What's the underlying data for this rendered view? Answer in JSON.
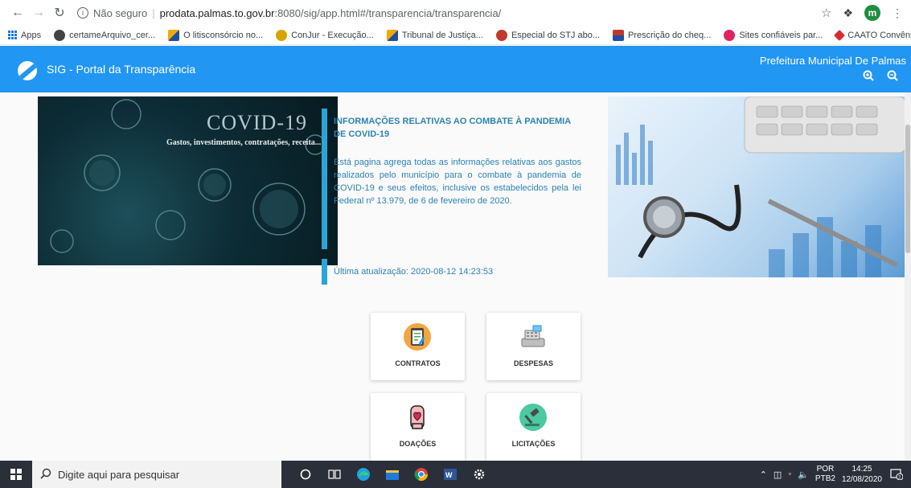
{
  "browser": {
    "security_label": "Não seguro",
    "host": "prodata.palmas.to.gov.br",
    "path": ":8080/sig/app.html#/transparencia/transparencia/",
    "profile_initial": "m"
  },
  "bookmarks": [
    {
      "label": "Apps"
    },
    {
      "label": "certameArquivo_cer..."
    },
    {
      "label": "O litisconsórcio no..."
    },
    {
      "label": "ConJur - Execução..."
    },
    {
      "label": "Tribunal de Justiça..."
    },
    {
      "label": "Especial do STJ abo..."
    },
    {
      "label": "Prescrição do cheq..."
    },
    {
      "label": "Sites confiáveis par..."
    },
    {
      "label": "CAATO Convênios"
    }
  ],
  "header": {
    "title": "SIG - Portal da Transparência",
    "city": "Prefeitura Municipal De Palmas",
    "zoom_in": "🔍+",
    "zoom_out": "🔍"
  },
  "banner": {
    "covid_title": "COVID-19",
    "covid_subtitle": "Gastos, investimentos, contratações, receita..."
  },
  "info": {
    "title": "INFORMAÇÕES RELATIVAS AO COMBATE À PANDEMIA DE COVID-19",
    "text": "Está pagina agrega todas as informações relativas aos gastos realizados pelo município para o combate à pandemia de COVID-19 e seus efeitos, inclusive os estabelecidos pela lei Federal nº 13.979, de 6 de fevereiro de 2020.",
    "updated": "Última atualização: 2020-08-12 14:23:53"
  },
  "cards": [
    {
      "label": "CONTRATOS"
    },
    {
      "label": "DESPESAS"
    },
    {
      "label": "DOAÇÕES"
    },
    {
      "label": "LICITAÇÕES"
    }
  ],
  "taskbar": {
    "search_placeholder": "Digite aqui para pesquisar",
    "lang_top": "POR",
    "lang_bottom": "PTB2",
    "time": "14:25",
    "date": "12/08/2020",
    "notif_count": "2"
  }
}
